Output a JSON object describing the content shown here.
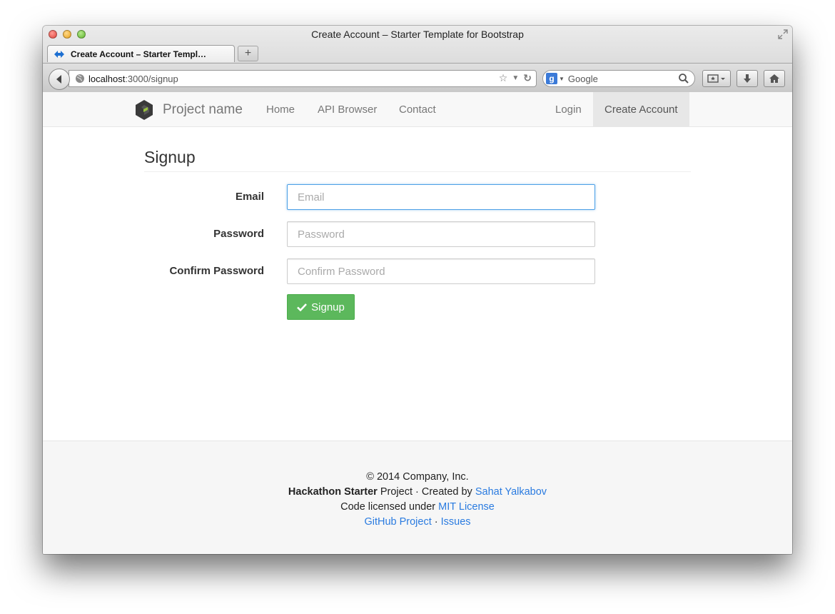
{
  "window": {
    "title": "Create Account – Starter Template for Bootstrap"
  },
  "tabs": [
    {
      "label": "Create Account – Starter Templ…",
      "active": true
    }
  ],
  "toolbar": {
    "url_host": "localhost",
    "url_path": ":3000/signup",
    "search_placeholder": "Google",
    "new_tab_label": "+"
  },
  "navbar": {
    "brand": "Project name",
    "links": [
      "Home",
      "API Browser",
      "Contact"
    ],
    "right_links": [
      "Login",
      "Create Account"
    ],
    "active_link": "Create Account"
  },
  "form": {
    "title": "Signup",
    "fields": [
      {
        "label": "Email",
        "placeholder": "Email",
        "value": "",
        "focused": true
      },
      {
        "label": "Password",
        "placeholder": "Password",
        "value": ""
      },
      {
        "label": "Confirm Password",
        "placeholder": "Confirm Password",
        "value": ""
      }
    ],
    "submit_label": "Signup",
    "submit_color": "#5cb85c"
  },
  "footer": {
    "copyright": "© 2014 Company, Inc.",
    "project_bold": "Hackathon Starter",
    "project_text": " Project · Created by ",
    "author_link": "Sahat Yalkabov",
    "license_text": "Code licensed under ",
    "license_link": "MIT License",
    "github_link": "GitHub Project",
    "separator": " · ",
    "issues_link": "Issues",
    "link_color": "#2a7be0"
  }
}
